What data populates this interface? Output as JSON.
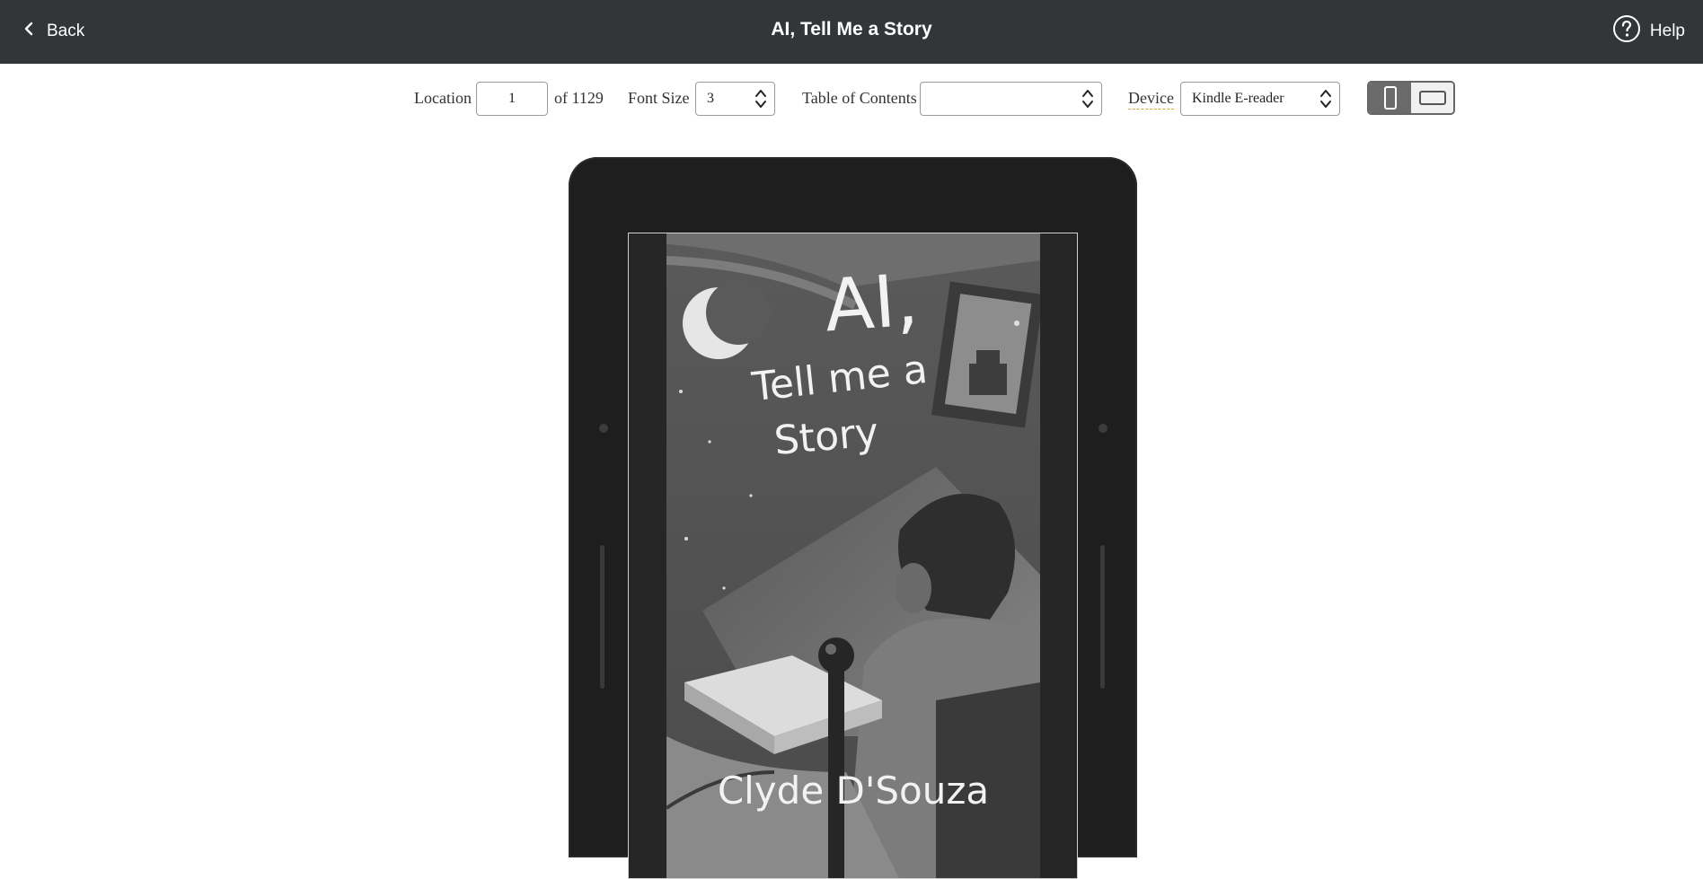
{
  "header": {
    "back_label": "Back",
    "title": "AI, Tell Me a Story",
    "help_label": "Help"
  },
  "toolbar": {
    "location_label": "Location",
    "location_value": "1",
    "location_total": "of 1129",
    "font_size_label": "Font Size",
    "font_size_value": "3",
    "toc_label": "Table of Contents",
    "toc_value": "",
    "device_label": "Device",
    "device_value": "Kindle E-reader",
    "orientation_selected": "portrait"
  },
  "book_cover": {
    "title_line1": "AI,",
    "title_line2": "Tell me a",
    "title_line3": "Story",
    "author": "Clyde D'Souza"
  },
  "colors": {
    "header_bg": "#323638",
    "device_body": "#1e1e1e",
    "accent_underline": "#d9a441"
  }
}
